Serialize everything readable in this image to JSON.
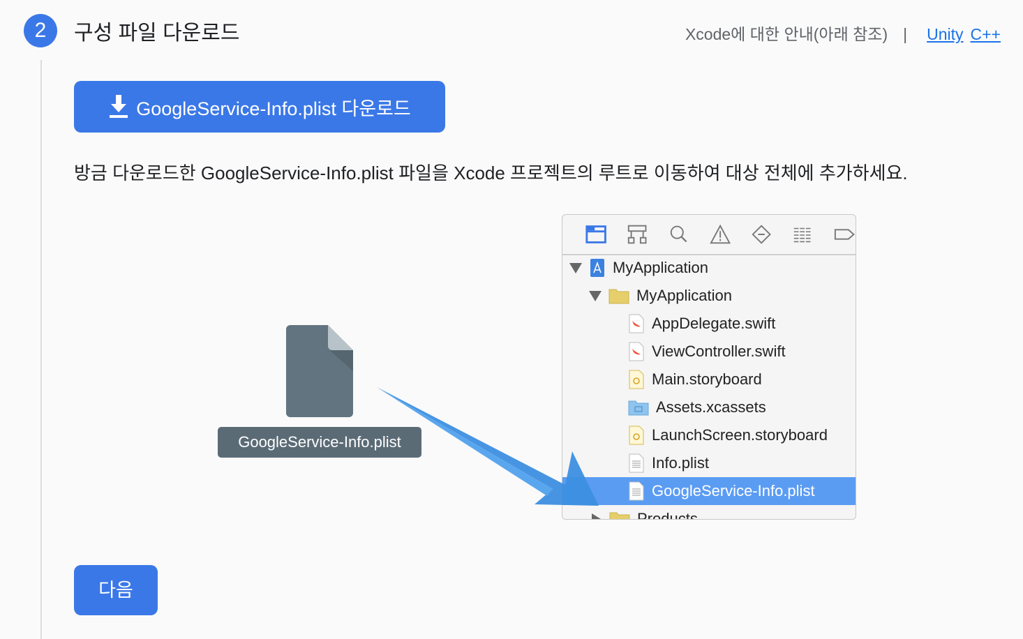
{
  "step": {
    "number": "2",
    "title": "구성 파일 다운로드"
  },
  "header_links": {
    "guide": "Xcode에 대한 안내(아래 참조)",
    "separator": "|",
    "unity": "Unity",
    "cpp": "C++"
  },
  "download_button": {
    "label": "GoogleService-Info.plist 다운로드",
    "icon": "download-icon"
  },
  "description": "방금 다운로드한 GoogleService-Info.plist 파일을 Xcode 프로젝트의 루트로 이동하여 대상 전체에 추가하세요.",
  "file_label": "GoogleService-Info.plist",
  "xcode_tree": [
    {
      "label": "MyApplication",
      "icon": "project-icon",
      "expanded": true,
      "level": 0
    },
    {
      "label": "MyApplication",
      "icon": "folder-icon",
      "expanded": true,
      "level": 1
    },
    {
      "label": "AppDelegate.swift",
      "icon": "swift-file-icon",
      "level": 2
    },
    {
      "label": "ViewController.swift",
      "icon": "swift-file-icon",
      "level": 2
    },
    {
      "label": "Main.storyboard",
      "icon": "storyboard-icon",
      "level": 2
    },
    {
      "label": "Assets.xcassets",
      "icon": "assets-folder-icon",
      "level": 2
    },
    {
      "label": "LaunchScreen.storyboard",
      "icon": "storyboard-icon",
      "level": 2
    },
    {
      "label": "Info.plist",
      "icon": "plist-icon",
      "level": 2
    },
    {
      "label": "GoogleService-Info.plist",
      "icon": "plist-icon",
      "level": 2,
      "selected": true
    },
    {
      "label": "Products",
      "icon": "folder-icon",
      "expanded": false,
      "level": 1
    }
  ],
  "next_button": "다음",
  "colors": {
    "accent": "#3b78e7",
    "selection": "#5b9cf3",
    "arrow": "#3d8fe0"
  }
}
